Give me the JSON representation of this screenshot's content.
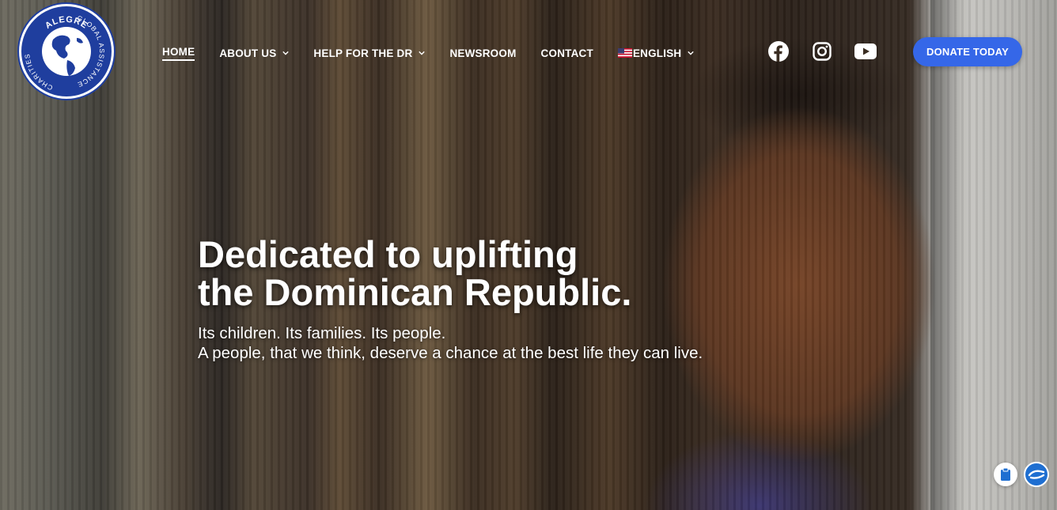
{
  "logo": {
    "text_top": "ALEGRE",
    "text_right": "GLOBAL ASSISTANCE",
    "text_left": "CHARITIES"
  },
  "nav": {
    "items": [
      {
        "label": "HOME",
        "active": true,
        "has_dropdown": false
      },
      {
        "label": "ABOUT US",
        "active": false,
        "has_dropdown": true
      },
      {
        "label": "HELP FOR THE DR",
        "active": false,
        "has_dropdown": true
      },
      {
        "label": "NEWSROOM",
        "active": false,
        "has_dropdown": false
      },
      {
        "label": "CONTACT",
        "active": false,
        "has_dropdown": false
      }
    ],
    "language": {
      "label": "ENGLISH",
      "icon": "us-flag-icon"
    }
  },
  "socials": [
    "facebook-icon",
    "instagram-icon",
    "youtube-icon"
  ],
  "donate_label": "DONATE TODAY",
  "hero": {
    "headline_line1": "Dedicated to uplifting",
    "headline_line2": "the Dominican Republic.",
    "sub_line1": "Its children. Its families. Its people.",
    "sub_line2": "A people, that we think, deserve a chance at the best life they can live."
  },
  "colors": {
    "accent": "#3567e8",
    "logo_blue": "#1f3e9e"
  }
}
